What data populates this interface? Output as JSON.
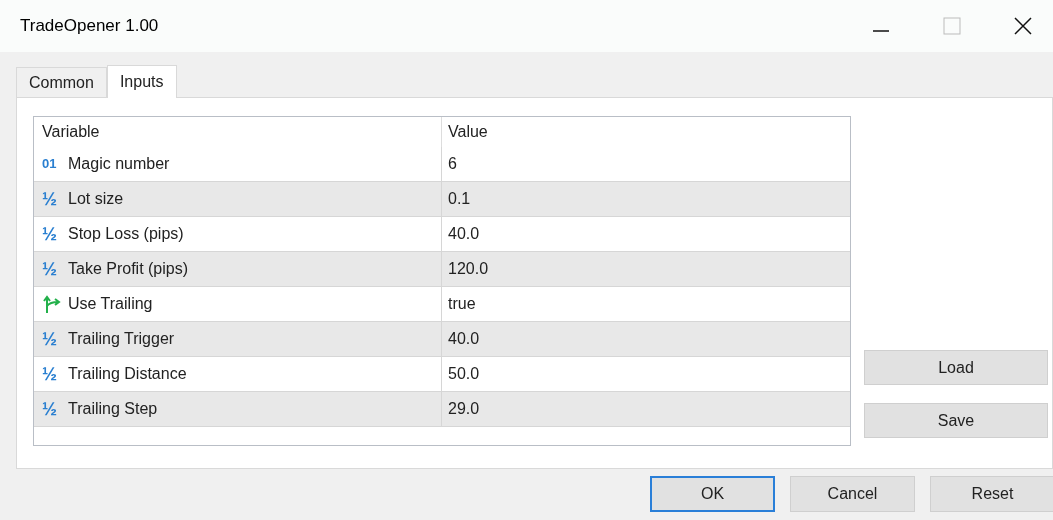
{
  "window": {
    "title": "TradeOpener 1.00"
  },
  "tabs": [
    {
      "label": "Common",
      "selected": false
    },
    {
      "label": "Inputs",
      "selected": true
    }
  ],
  "table": {
    "columns": [
      "Variable",
      "Value"
    ],
    "rows": [
      {
        "kind": "integer",
        "glyph": "01",
        "variable": "Magic number",
        "value": "6"
      },
      {
        "kind": "double",
        "glyph": "½",
        "variable": "Lot size",
        "value": "0.1"
      },
      {
        "kind": "double",
        "glyph": "½",
        "variable": "Stop Loss (pips)",
        "value": "40.0"
      },
      {
        "kind": "double",
        "glyph": "½",
        "variable": "Take Profit (pips)",
        "value": "120.0"
      },
      {
        "kind": "bool",
        "variable": "Use Trailing",
        "value": "true"
      },
      {
        "kind": "double",
        "glyph": "½",
        "variable": "Trailing Trigger",
        "value": "40.0"
      },
      {
        "kind": "double",
        "glyph": "½",
        "variable": "Trailing Distance",
        "value": "50.0"
      },
      {
        "kind": "double",
        "glyph": "½",
        "variable": "Trailing Step",
        "value": "29.0"
      }
    ]
  },
  "side_buttons": [
    "Load",
    "Save"
  ],
  "footer_buttons": [
    {
      "label": "OK",
      "selected": true
    },
    {
      "label": "Cancel",
      "selected": false
    },
    {
      "label": "Reset",
      "selected": false
    }
  ]
}
